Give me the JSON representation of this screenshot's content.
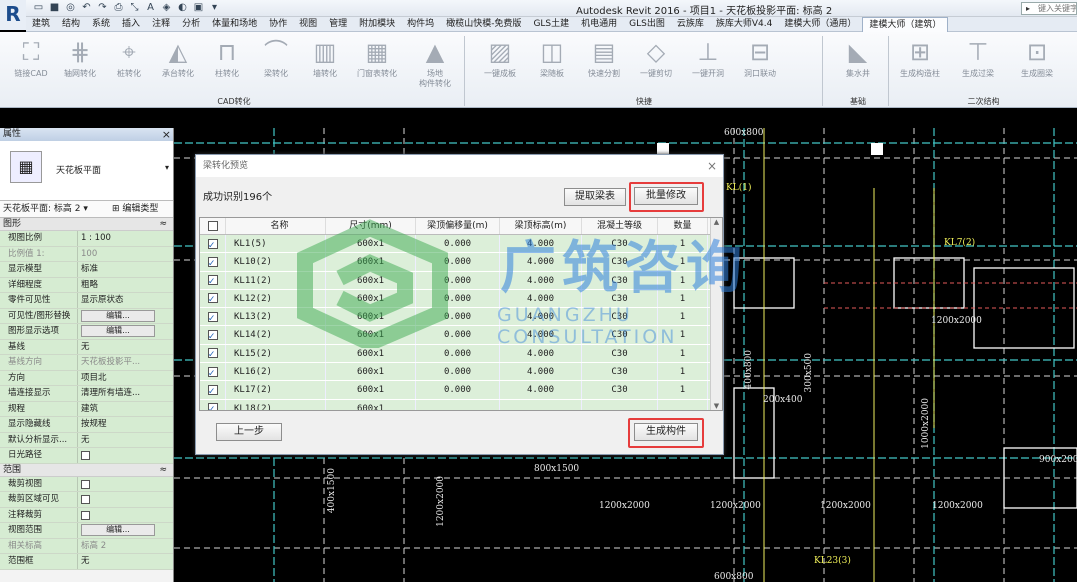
{
  "window": {
    "title": "Autodesk Revit 2016 -      项目1 - 天花板投影平面: 标高 2",
    "search_placeholder": "键入关键字"
  },
  "app_button": "R",
  "tabs": [
    "建筑",
    "结构",
    "系统",
    "插入",
    "注释",
    "分析",
    "体量和场地",
    "协作",
    "视图",
    "管理",
    "附加模块",
    "构件坞",
    "橄榄山快模-免费版",
    "GLS土建",
    "机电通用",
    "GLS出图",
    "云族库",
    "族库大师V4.4",
    "建模大师（通用）",
    "建模大师（建筑）"
  ],
  "active_tab": "建模大师（建筑）",
  "ribbon": {
    "groups": [
      {
        "label": "CAD转化",
        "tools": [
          [
            "链接CAD"
          ],
          [
            "轴网转化"
          ],
          [
            "桩转化"
          ],
          [
            "承台转化"
          ],
          [
            "柱转化"
          ],
          [
            "梁转化"
          ],
          [
            "墙转化"
          ],
          [
            "门窗表转化"
          ],
          [
            "场地",
            "构件转化"
          ]
        ]
      },
      {
        "label": "快捷",
        "tools": [
          [
            "一键成板"
          ],
          [
            "梁随板"
          ],
          [
            "快速分割"
          ],
          [
            "一键剪切"
          ],
          [
            "一键开洞"
          ],
          [
            "洞口联动"
          ]
        ]
      },
      {
        "label": "基础",
        "tools": [
          [
            "集水井"
          ]
        ]
      },
      {
        "label": "二次结构",
        "tools": [
          [
            "生成构造柱"
          ],
          [
            "生成过梁"
          ],
          [
            "生成圈梁"
          ]
        ]
      }
    ]
  },
  "properties": {
    "header": "属性",
    "type_name": "天花板平面",
    "view_selector": "天花板平面: 标高 2",
    "edit_type": "编辑类型",
    "sections": [
      {
        "name": "图形",
        "rows": [
          {
            "k": "视图比例",
            "v": "1 : 100",
            "grey": false
          },
          {
            "k": "比例值 1:",
            "v": "100",
            "grey": true
          },
          {
            "k": "显示模型",
            "v": "标准",
            "grey": false
          },
          {
            "k": "详细程度",
            "v": "粗略",
            "grey": false
          },
          {
            "k": "零件可见性",
            "v": "显示原状态",
            "grey": false
          },
          {
            "k": "可见性/图形替换",
            "v": "编辑...",
            "btn": true
          },
          {
            "k": "图形显示选项",
            "v": "编辑...",
            "btn": true
          },
          {
            "k": "基线",
            "v": "无",
            "grey": false
          },
          {
            "k": "基线方向",
            "v": "天花板投影平...",
            "grey": true
          },
          {
            "k": "方向",
            "v": "项目北",
            "grey": false
          },
          {
            "k": "墙连接显示",
            "v": "清理所有墙连...",
            "grey": false
          },
          {
            "k": "规程",
            "v": "建筑",
            "grey": false
          },
          {
            "k": "显示隐藏线",
            "v": "按规程",
            "grey": false
          },
          {
            "k": "默认分析显示...",
            "v": "无",
            "grey": false
          },
          {
            "k": "日光路径",
            "v": "",
            "chk": true
          }
        ]
      },
      {
        "name": "范围",
        "rows": [
          {
            "k": "裁剪视图",
            "v": "",
            "chk": true
          },
          {
            "k": "裁剪区域可见",
            "v": "",
            "chk": true
          },
          {
            "k": "注释裁剪",
            "v": "",
            "chk": true
          },
          {
            "k": "视图范围",
            "v": "编辑...",
            "btn": true
          },
          {
            "k": "相关标高",
            "v": "标高 2",
            "grey": true
          },
          {
            "k": "范围框",
            "v": "无",
            "grey": false
          }
        ]
      }
    ]
  },
  "dialog": {
    "title": "梁转化预览",
    "count_text": "成功识别196个",
    "extract_btn": "提取梁表",
    "batch_btn": "批量修改",
    "prev_btn": "上一步",
    "generate_btn": "生成构件",
    "columns": [
      "",
      "名称",
      "尺寸(mm)",
      "梁顶偏移量(m)",
      "梁顶标高(m)",
      "混凝土等级",
      "数量"
    ],
    "rows": [
      [
        "KL1(5)",
        "600x1",
        "0.000",
        "4.000",
        "C30",
        "1"
      ],
      [
        "KL10(2)",
        "600x1",
        "0.000",
        "4.000",
        "C30",
        "1"
      ],
      [
        "KL11(2)",
        "600x1",
        "0.000",
        "4.000",
        "C30",
        "1"
      ],
      [
        "KL12(2)",
        "600x1",
        "0.000",
        "4.000",
        "C30",
        "1"
      ],
      [
        "KL13(2)",
        "600x1",
        "0.000",
        "4.000",
        "C30",
        "1"
      ],
      [
        "KL14(2)",
        "600x1",
        "0.000",
        "4.000",
        "C30",
        "1"
      ],
      [
        "KL15(2)",
        "600x1",
        "0.000",
        "4.000",
        "C30",
        "1"
      ],
      [
        "KL16(2)",
        "600x1",
        "0.000",
        "4.000",
        "C30",
        "1"
      ],
      [
        "KL17(2)",
        "600x1",
        "0.000",
        "4.000",
        "C30",
        "1"
      ],
      [
        "KL18(2)",
        "600x1",
        "",
        "",
        "",
        ""
      ]
    ]
  },
  "watermark": {
    "cn": "广筑咨询",
    "en": "GUANGZHU CONSULTATION"
  },
  "cad_labels": [
    {
      "t": "600x800",
      "cls": ""
    },
    {
      "t": "1200x2000",
      "cls": ""
    },
    {
      "t": "200x400",
      "cls": ""
    },
    {
      "t": "1200x2000",
      "cls": ""
    },
    {
      "t": "800x1500",
      "cls": ""
    },
    {
      "t": "1200x2000",
      "cls": ""
    },
    {
      "t": "1200x2000",
      "cls": ""
    },
    {
      "t": "900x2000",
      "cls": ""
    },
    {
      "t": "1200x2000",
      "cls": ""
    },
    {
      "t": "600x800",
      "cls": ""
    },
    {
      "t": "400x1500",
      "cls": "v"
    },
    {
      "t": "1200x2000",
      "cls": "v"
    },
    {
      "t": "1000x2000",
      "cls": "v"
    },
    {
      "t": "300x500",
      "cls": "v"
    },
    {
      "t": "400x800",
      "cls": "v"
    },
    {
      "t": "KL(1)",
      "cls": "y"
    },
    {
      "t": "KL7(2)",
      "cls": "y"
    },
    {
      "t": "KL23(3)",
      "cls": "y"
    }
  ],
  "colors": {
    "accent_red": "#e63c3c",
    "row_green": "#dcefd9",
    "prop_green": "#d6ecd2"
  }
}
